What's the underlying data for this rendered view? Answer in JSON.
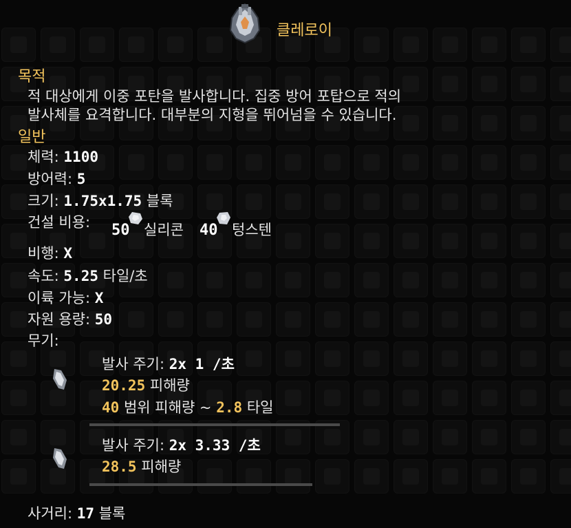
{
  "unit": {
    "name": "클레로이",
    "icon": "unit-icon"
  },
  "sections": {
    "purpose_header": "목적",
    "purpose_line1": "적 대상에게 이중 포탄을 발사합니다. 집중 방어 포탑으로 적의",
    "purpose_line2": "발사체를 요격합니다. 대부분의 지형을 뛰어넘을 수 있습니다.",
    "general_header": "일반"
  },
  "stats": {
    "health_label": "체력:",
    "health_value": "1100",
    "armor_label": "방어력:",
    "armor_value": "5",
    "size_label": "크기:",
    "size_value": "1.75x1.75",
    "size_unit": "블록",
    "build_cost_label": "건설 비용:",
    "cost": [
      {
        "amount": "50",
        "name": "실리콘",
        "icon": "silicon-icon"
      },
      {
        "amount": "40",
        "name": "텅스텐",
        "icon": "tungsten-icon"
      }
    ],
    "flying_label": "비행:",
    "flying_value": "X",
    "speed_label": "속도:",
    "speed_value": "5.25",
    "speed_unit": "타일/초",
    "canboost_label": "이륙 가능:",
    "canboost_value": "X",
    "capacity_label": "자원 용량:",
    "capacity_value": "50",
    "weapons_label": "무기:"
  },
  "weapons": [
    {
      "reload_label": "발사 주기:",
      "reload_value": "2x 1 /초",
      "damage_value": "20.25",
      "damage_label": "피해량",
      "splash_value": "40",
      "splash_label": "범위 피해량 ~",
      "splash_radius": "2.8",
      "splash_unit": "타일",
      "icon": "bullet-icon"
    },
    {
      "reload_label": "발사 주기:",
      "reload_value": "2x 3.33 /초",
      "damage_value": "28.5",
      "damage_label": "피해량",
      "icon": "bullet-icon"
    }
  ],
  "range": {
    "label": "사거리:",
    "value": "17",
    "unit": "블록"
  },
  "colors": {
    "accent": "#f2c35c",
    "background": "#0b0b0b",
    "text": "#e4e4e4",
    "divider": "#4a4a4a"
  }
}
